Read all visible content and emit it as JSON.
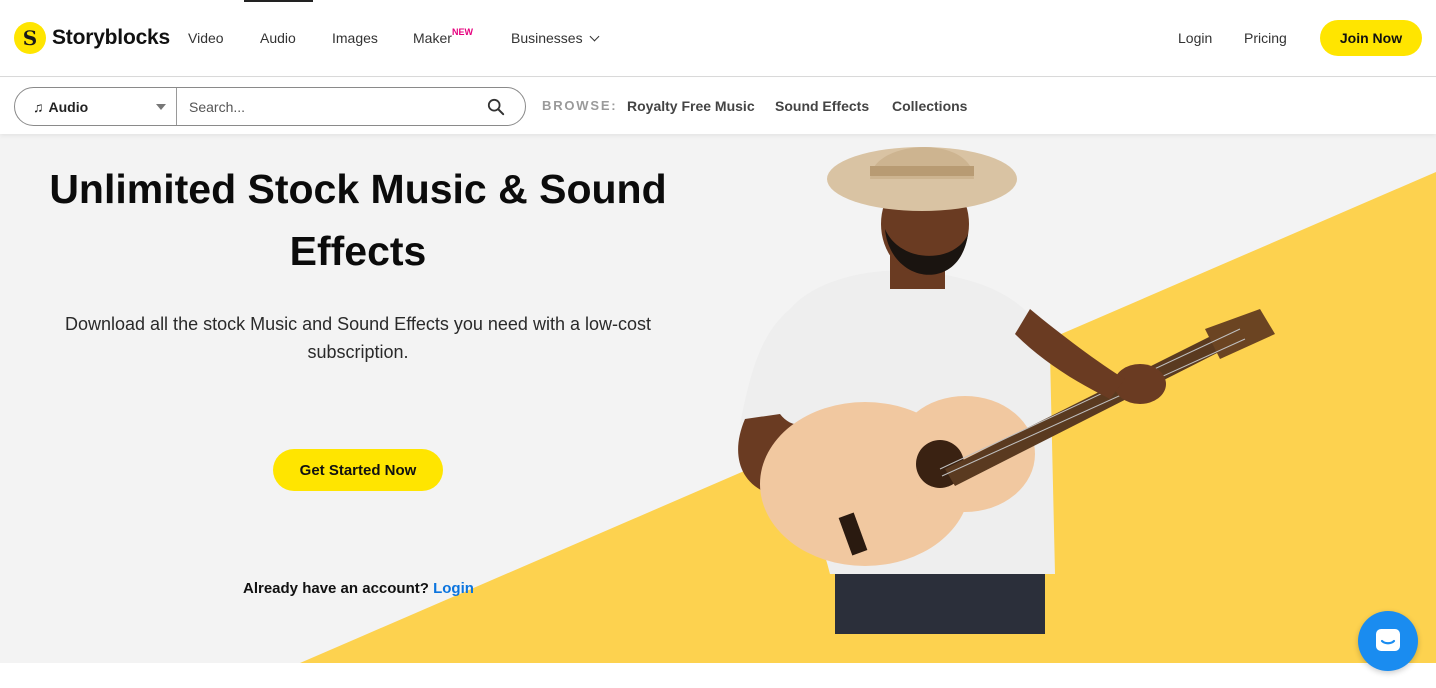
{
  "brand": {
    "name": "Storyblocks",
    "mark": "S",
    "accent": "#ffe500"
  },
  "nav": {
    "video": "Video",
    "audio": "Audio",
    "images": "Images",
    "maker": "Maker",
    "maker_badge": "NEW",
    "businesses": "Businesses",
    "login": "Login",
    "pricing": "Pricing",
    "join": "Join Now"
  },
  "search": {
    "media_type": "Audio",
    "placeholder": "Search...",
    "browse_label": "BROWSE:",
    "browse_links": [
      "Royalty Free Music",
      "Sound Effects",
      "Collections"
    ]
  },
  "hero": {
    "headline": "Unlimited Stock Music & Sound Effects",
    "subhead": "Download all the stock Music and Sound Effects you need with a low-cost subscription.",
    "cta": "Get Started Now",
    "account_prompt": "Already have an account?",
    "account_login": "Login",
    "link_color": "#0b74de",
    "yellow": "#fdd24f"
  },
  "icons": [
    "music-note-icon",
    "search-icon",
    "chevron-down-icon",
    "chat-icon"
  ]
}
